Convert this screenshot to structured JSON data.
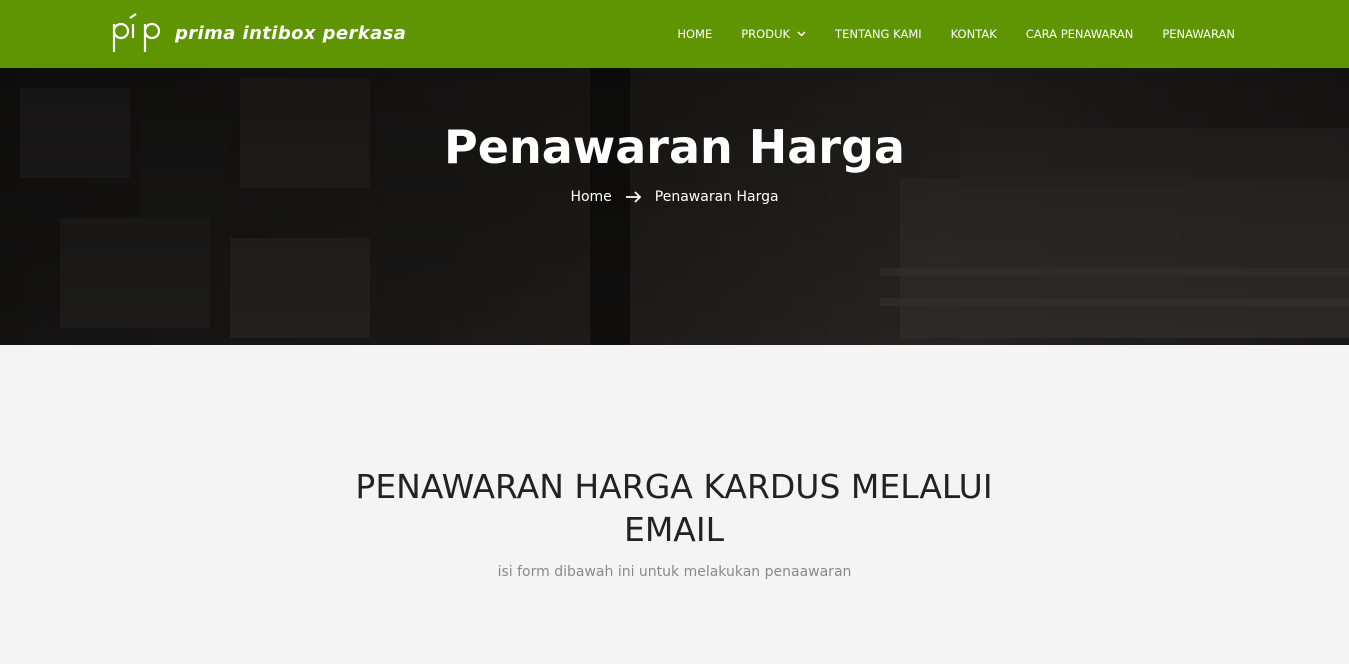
{
  "header": {
    "logo_text": "pip",
    "brand_name": "prima intibox perkasa",
    "bg_color": "#5f9402",
    "nav": [
      {
        "label": "HOME",
        "icon": null
      },
      {
        "label": "PRODUK",
        "icon": "chevron-down-icon"
      },
      {
        "label": "TENTANG KAMI",
        "icon": null
      },
      {
        "label": "KONTAK",
        "icon": null
      },
      {
        "label": "CARA PENAWARAN",
        "icon": null
      },
      {
        "label": "PENAWARAN",
        "icon": null
      }
    ]
  },
  "hero": {
    "title": "Penawaran Harga",
    "breadcrumb": {
      "home": "Home",
      "separator_icon": "arrow-right-icon",
      "current": "Penawaran Harga"
    }
  },
  "section": {
    "title": "PENAWARAN HARGA KARDUS MELALUI EMAIL",
    "subtitle": "isi form dibawah ini untuk melakukan penaawaran"
  }
}
